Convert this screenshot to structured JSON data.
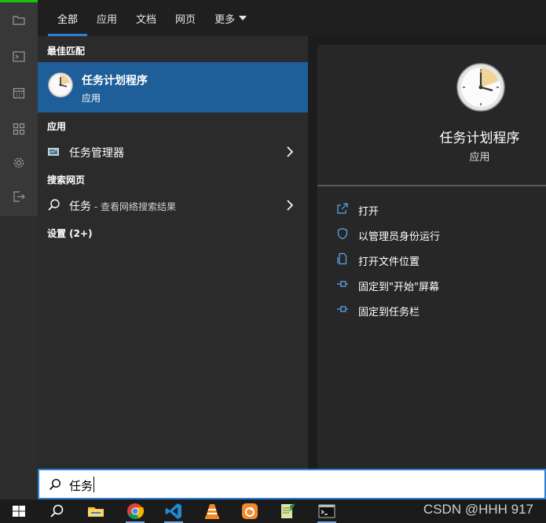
{
  "tabs": [
    {
      "label": "全部",
      "active": true
    },
    {
      "label": "应用",
      "active": false
    },
    {
      "label": "文档",
      "active": false
    },
    {
      "label": "网页",
      "active": false
    },
    {
      "label": "更多",
      "active": false,
      "has_dropdown": true
    }
  ],
  "results": {
    "best_match_header": "最佳匹配",
    "best_match": {
      "name": "任务计划程序",
      "type": "应用",
      "icon": "clock-icon"
    },
    "apps_header": "应用",
    "apps": [
      {
        "label": "任务管理器",
        "icon": "task-manager-icon"
      }
    ],
    "web_header": "搜索网页",
    "web": [
      {
        "query": "任务",
        "sub": " - 查看网络搜索结果",
        "icon": "search-icon"
      }
    ],
    "settings_header": "设置 (2+)"
  },
  "detail": {
    "title": "任务计划程序",
    "type": "应用",
    "icon": "clock-icon",
    "actions": [
      {
        "label": "打开",
        "icon": "open-icon"
      },
      {
        "label": "以管理员身份运行",
        "icon": "shield-icon"
      },
      {
        "label": "打开文件位置",
        "icon": "file-location-icon"
      },
      {
        "label": "固定到\"开始\"屏幕",
        "icon": "pin-icon"
      },
      {
        "label": "固定到任务栏",
        "icon": "pin-icon"
      }
    ]
  },
  "search": {
    "value": "任务"
  },
  "rail_icons": [
    "folder-icon",
    "terminal-icon",
    "calendar-icon",
    "apps-grid-icon",
    "gear-icon",
    "sign-out-icon"
  ],
  "taskbar": {
    "items": [
      "windows-start-icon",
      "search-icon",
      "file-explorer-icon",
      "chrome-icon",
      "vscode-icon",
      "vlc-icon",
      "uc-browser-icon",
      "notepad-icon",
      "cmd-icon"
    ],
    "watermark": "CSDN @HHH 917"
  },
  "colors": {
    "accent": "#2b7fd4",
    "selected": "#1e5e99",
    "panel": "#2b2b2b",
    "detail": "#272727"
  }
}
